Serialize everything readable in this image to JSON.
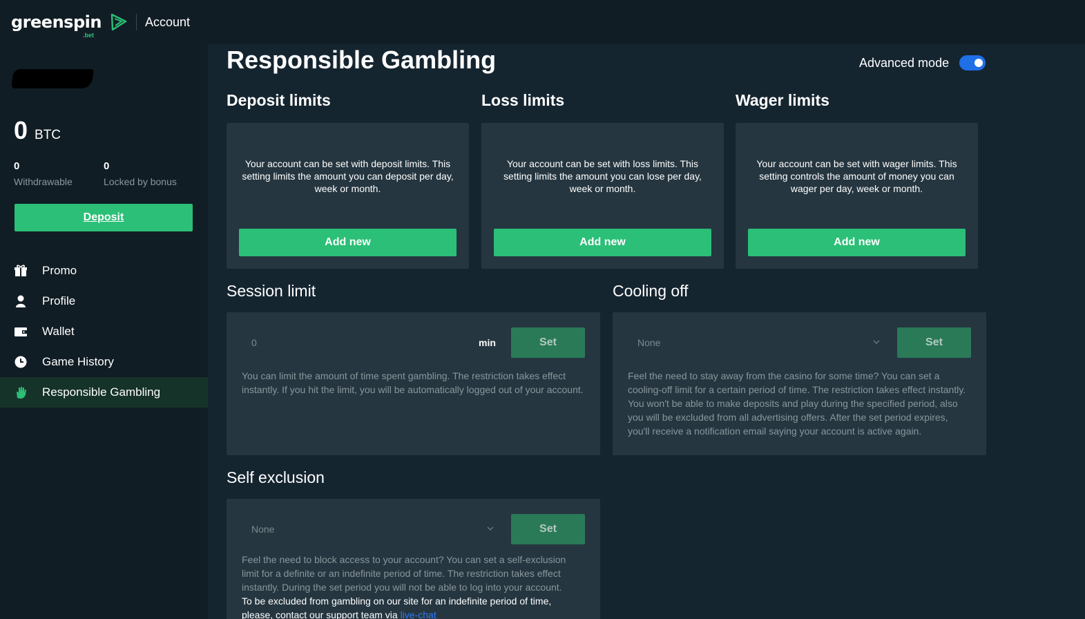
{
  "topbar": {
    "logo_text": "greenspin",
    "logo_suffix": ".bet",
    "section_title": "Account"
  },
  "sidebar": {
    "balance": {
      "amount": "0",
      "currency": "BTC"
    },
    "withdrawable": {
      "value": "0",
      "label": "Withdrawable"
    },
    "locked": {
      "value": "0",
      "label": "Locked by bonus"
    },
    "deposit_label": "Deposit",
    "nav": [
      {
        "label": "Promo",
        "icon": "gift-icon"
      },
      {
        "label": "Profile",
        "icon": "user-icon"
      },
      {
        "label": "Wallet",
        "icon": "wallet-icon"
      },
      {
        "label": "Game History",
        "icon": "clock-icon"
      },
      {
        "label": "Responsible Gambling",
        "icon": "hand-icon",
        "active": true
      }
    ]
  },
  "main": {
    "title": "Responsible Gambling",
    "advanced_mode_label": "Advanced mode",
    "advanced_mode_on": true,
    "limits": [
      {
        "title": "Deposit limits",
        "description": "Your account can be set with deposit limits. This setting limits the amount you can deposit per day, week or month.",
        "button": "Add new"
      },
      {
        "title": "Loss limits",
        "description": "Your account can be set with loss limits. This setting limits the amount you can lose per day, week or month.",
        "button": "Add new"
      },
      {
        "title": "Wager limits",
        "description": "Your account can be set with wager limits. This setting controls the amount of money you can wager per day, week or month.",
        "button": "Add new"
      }
    ],
    "session": {
      "title": "Session limit",
      "input_placeholder": "0",
      "unit": "min",
      "button": "Set",
      "description": "You can limit the amount of time spent gambling. The restriction takes effect instantly. If you hit the limit, you will be automatically logged out of your account."
    },
    "cooling": {
      "title": "Cooling off",
      "select_value": "None",
      "button": "Set",
      "description": "Feel the need to stay away from the casino for some time? You can set a cooling-off limit for a certain period of time. The restriction takes effect instantly. You won't be able to make deposits and play during the specified period, also you will be excluded from all advertising offers. After the set period expires, you'll receive a notification email saying your account is active again."
    },
    "self_exclusion": {
      "title": "Self exclusion",
      "select_value": "None",
      "button": "Set",
      "description": "Feel the need to block access to your account? You can set a self-exclusion limit for a definite or an indefinite period of time. The restriction takes effect instantly. During the set period you will not be able to log into your account.",
      "note": "To be excluded from gambling on our site for an indefinite period of time, please, contact our support team via ",
      "link": "live-chat"
    }
  },
  "colors": {
    "accent_green": "#2bbf77",
    "toggle_blue": "#1f6fe6",
    "link_blue": "#2f78ff"
  }
}
